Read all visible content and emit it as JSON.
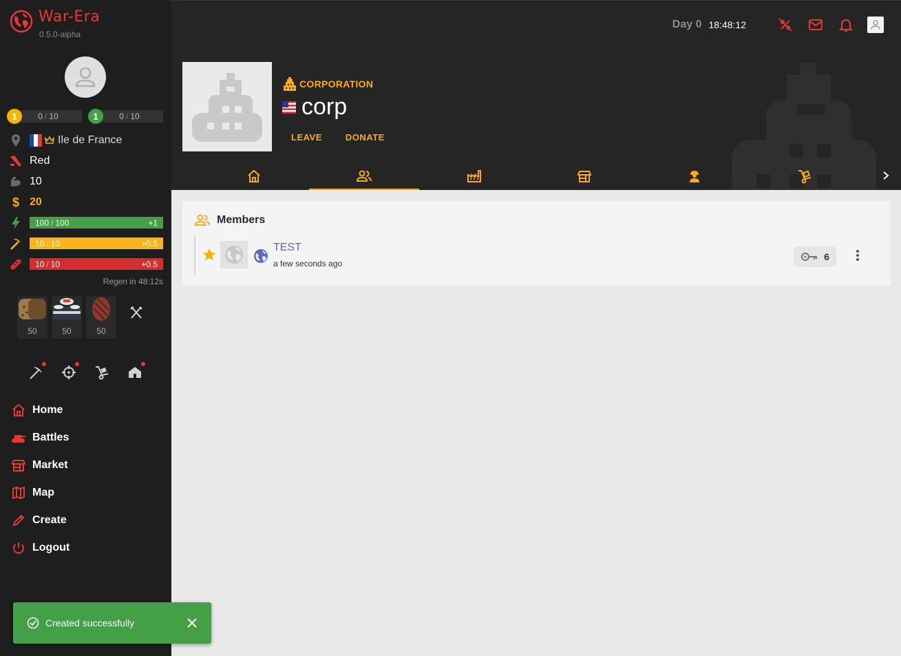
{
  "app": {
    "name": "War-Era",
    "version": "0.5.0-alpha"
  },
  "user": {
    "level_a": {
      "badge": "1",
      "value": "0",
      "max": "10",
      "color": "#f5b400"
    },
    "level_b": {
      "badge": "1",
      "value": "0",
      "max": "10",
      "color": "#43a047"
    },
    "region": "Ile de France",
    "party": "Red",
    "strength": "10",
    "money": "20"
  },
  "bars": {
    "health": {
      "value": "100",
      "max": "100",
      "regen": "+1",
      "color": "#43a047",
      "fill": 1.0
    },
    "work": {
      "value": "10",
      "max": "10",
      "regen": "+0.5",
      "color": "#fbb41a",
      "fill": 1.0
    },
    "hunger": {
      "value": "10",
      "max": "10",
      "regen": "+0.5",
      "color": "#d32f2f",
      "fill": 1.0
    },
    "regen_text": "Regen in 48:12s"
  },
  "food": [
    {
      "name": "bread",
      "qty": "50"
    },
    {
      "name": "sushi",
      "qty": "50"
    },
    {
      "name": "steak",
      "qty": "50"
    }
  ],
  "nav": {
    "home": "Home",
    "battles": "Battles",
    "market": "Market",
    "map": "Map",
    "create": "Create",
    "logout": "Logout"
  },
  "toast": {
    "message": "Created successfully"
  },
  "topbar": {
    "day": "Day 0",
    "time": "18:48:12"
  },
  "corporation": {
    "type_label": "CORPORATION",
    "name": "corp",
    "actions": {
      "leave": "LEAVE",
      "donate": "DONATE"
    }
  },
  "tabs": [
    "home",
    "members",
    "companies",
    "market",
    "workers",
    "transport"
  ],
  "active_tab": "members",
  "members": {
    "title": "Members",
    "list": [
      {
        "name": "TEST",
        "time": "a few seconds ago",
        "keys": "6"
      }
    ]
  },
  "colors": {
    "accent": "#fbaa19",
    "brand": "#e53935",
    "sidebar_bg": "#1e1e1e",
    "header_bg": "#252525",
    "link": "#5c6bc0"
  }
}
